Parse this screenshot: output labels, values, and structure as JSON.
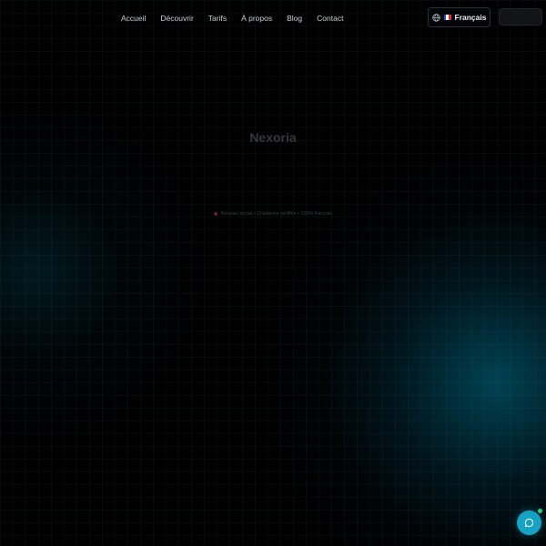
{
  "nav": {
    "links": [
      "Accueil",
      "Découvrir",
      "Tarifs",
      "À propos",
      "Blog",
      "Contact"
    ]
  },
  "language": {
    "icon": "globe-icon",
    "flag": "france-flag-icon",
    "label": "Français"
  },
  "auth_button": {
    "label": ""
  },
  "hero": {
    "brand": "Nexoria",
    "tagline": "Réseau social • Créateurs vérifiés • 100% français"
  },
  "chat": {
    "icon": "chat-bubble-icon",
    "status": "online"
  },
  "colors": {
    "background": "#000000",
    "accent": "#16a2c4",
    "online": "#27d07a",
    "tag_dot": "#6b1d24"
  }
}
